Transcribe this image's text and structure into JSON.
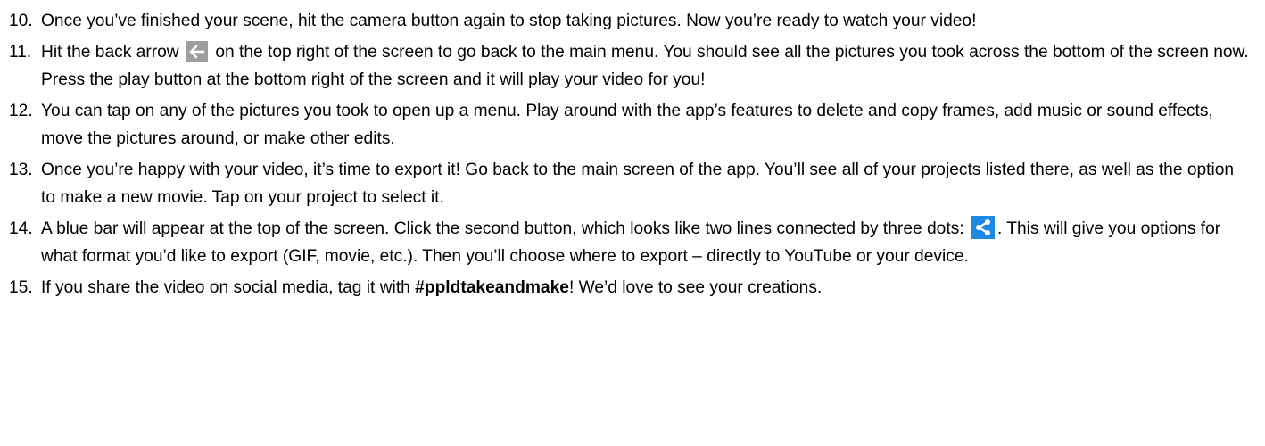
{
  "steps": [
    {
      "number": "10.",
      "text": "Once you’ve finished your scene, hit the camera button again to stop taking pictures. Now you’re ready to watch your video!"
    },
    {
      "number": "11.",
      "before_icon": "Hit the back arrow",
      "icon": "back-arrow-icon",
      "after_icon": "on the top right of the screen to go back to the main menu. You should see all the pictures you took across the bottom of the screen now. Press the play button at the bottom right of the screen and it will play your video for you!"
    },
    {
      "number": "12.",
      "text": "You can tap on any of the pictures you took to open up a menu. Play around with the app’s features to delete and copy frames, add music or sound effects, move the pictures around, or make other edits."
    },
    {
      "number": "13.",
      "text": "Once you’re happy with your video, it’s time to export it! Go back to the main screen of the app. You’ll see all of your projects listed there, as well as the option to make a new movie. Tap on your project to select it."
    },
    {
      "number": "14.",
      "before_icon": "A blue bar will appear at the top of the screen. Click the second button, which looks like two lines connected by three dots:",
      "icon": "share-icon",
      "after_icon": ". This will give you options for what format you’d like to export (GIF, movie, etc.). Then you’ll choose where to export – directly to YouTube or your device."
    },
    {
      "number": "15.",
      "before_bold": "If you share the video on social media, tag it with",
      "bold": "#ppldtakeandmake",
      "after_bold": "! We’d love to see your creations."
    }
  ],
  "colors": {
    "back_icon_bg": "#9e9e9e",
    "share_icon_bg": "#1e88e5",
    "text": "#000000"
  }
}
